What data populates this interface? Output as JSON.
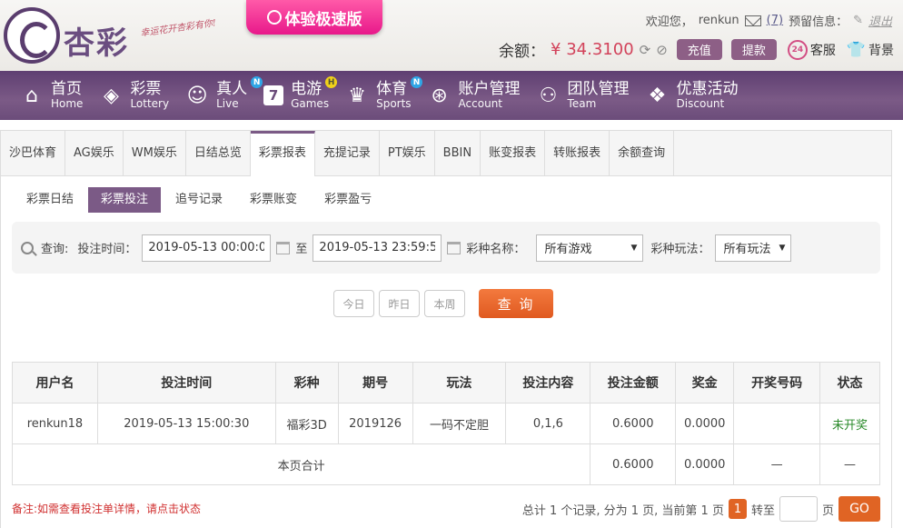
{
  "header": {
    "brand": "杏彩",
    "slogan": "幸运花开杏彩有你!",
    "promo_label": "体验极速版",
    "welcome": "欢迎您，",
    "username": "renkun",
    "mail_count": "(7)",
    "reserve_label": "预留信息：",
    "logout": "退出",
    "balance_label": "余额：",
    "balance": "¥ 34.3100",
    "recharge": "充值",
    "withdraw": "提款",
    "service": "客服",
    "background": "背景"
  },
  "nav": {
    "items": [
      {
        "cn": "首页",
        "en": "Home",
        "icon": "home-icon"
      },
      {
        "cn": "彩票",
        "en": "Lottery",
        "icon": "lottery-icon"
      },
      {
        "cn": "真人",
        "en": "Live",
        "icon": "live-icon",
        "badge": "N"
      },
      {
        "cn": "电游",
        "en": "Games",
        "icon": "games-icon",
        "badge": "H"
      },
      {
        "cn": "体育",
        "en": "Sports",
        "icon": "trophy-icon",
        "badge": "N"
      },
      {
        "cn": "账户管理",
        "en": "Account",
        "icon": "account-icon"
      },
      {
        "cn": "团队管理",
        "en": "Team",
        "icon": "team-icon"
      },
      {
        "cn": "优惠活动",
        "en": "Discount",
        "icon": "gift-icon"
      }
    ]
  },
  "tabs": [
    "沙巴体育",
    "AG娱乐",
    "WM娱乐",
    "日结总览",
    "彩票报表",
    "充提记录",
    "PT娱乐",
    "BBIN",
    "账变报表",
    "转账报表",
    "余额查询"
  ],
  "active_tab": "彩票报表",
  "subtabs": [
    "彩票日结",
    "彩票投注",
    "追号记录",
    "彩票账变",
    "彩票盈亏"
  ],
  "active_subtab": "彩票投注",
  "filter": {
    "query_label": "查询:",
    "time_label": "投注时间：",
    "start": "2019-05-13 00:00:00",
    "to": "至",
    "end": "2019-05-13 23:59:59",
    "game_label": "彩种名称：",
    "game_value": "所有游戏",
    "play_label": "彩种玩法：",
    "play_value": "所有玩法"
  },
  "quick": {
    "today": "今日",
    "yesterday": "昨日",
    "week": "本周",
    "search": "查 询"
  },
  "table": {
    "headers": [
      "用户名",
      "投注时间",
      "彩种",
      "期号",
      "玩法",
      "投注内容",
      "投注金额",
      "奖金",
      "开奖号码",
      "状态"
    ],
    "rows": [
      [
        "renkun18",
        "2019-05-13 15:00:30",
        "福彩3D",
        "2019126",
        "一码不定胆",
        "0,1,6",
        "0.6000",
        "0.0000",
        "",
        "未开奖"
      ]
    ],
    "total": {
      "label": "本页合计",
      "amount": "0.6000",
      "bonus": "0.0000",
      "draw": "—",
      "status": "—"
    }
  },
  "footer": {
    "note": "备注:如需查看投注单详情，请点击状态",
    "summary": "总计 1 个记录, 分为 1 页, 当前第 1 页",
    "current_page": "1",
    "goto_label": "转至",
    "page_unit": "页",
    "go": "GO"
  },
  "colors": {
    "accent": "#7b5a86",
    "orange": "#e06424",
    "price": "#d2425a"
  }
}
